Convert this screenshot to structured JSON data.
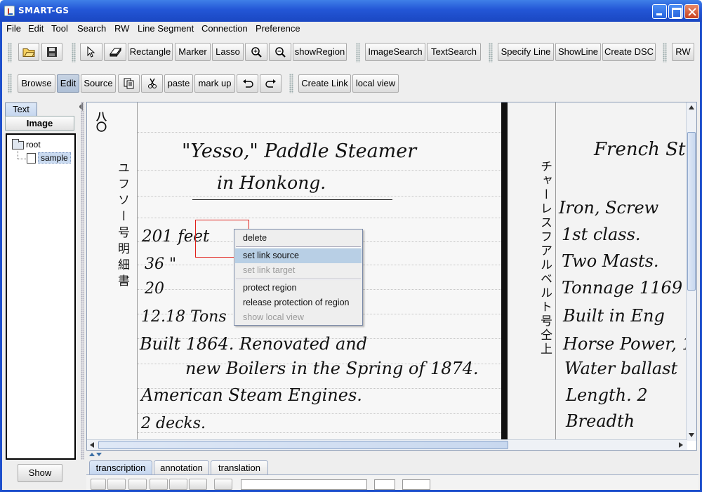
{
  "window": {
    "title": "SMART-GS"
  },
  "menu": [
    "File",
    "Edit",
    "Tool",
    "Search",
    "RW",
    "Line Segment",
    "Connection",
    "Preference"
  ],
  "toolbar1": {
    "open_icon": "open-folder-icon",
    "save_icon": "save-disk-icon",
    "pointer_icon": "pointer-arrow-icon",
    "eraser_icon": "eraser-icon",
    "rectangle": "Rectangle",
    "marker": "Marker",
    "lasso": "Lasso",
    "zoom_in_icon": "zoom-in-icon",
    "zoom_out_icon": "zoom-out-icon",
    "show_region": "showRegion",
    "image_search": "ImageSearch",
    "text_search": "TextSearch",
    "specify_line": "Specify Line",
    "show_line": "ShowLine",
    "create_dsc": "Create DSC",
    "rw": "RW"
  },
  "toolbar2": {
    "browse": "Browse",
    "edit": "Edit",
    "source": "Source",
    "copy_icon": "copy-icon",
    "cut_icon": "scissors-icon",
    "paste": "paste",
    "mark_up": "mark up",
    "undo_icon": "undo-icon",
    "redo_icon": "redo-icon",
    "create_link": "Create Link",
    "local_view": "local view"
  },
  "left_panel": {
    "tab_text": "Text",
    "tab_image": "Image",
    "tree": {
      "root": "root",
      "child": "sample"
    },
    "show_button": "Show"
  },
  "document": {
    "page_number": "八〇",
    "vertical_jp_left": "ユフソー号明細書",
    "vertical_jp_right": "チャーレスフアルベルト号仝上",
    "left_lines": [
      "\"Yesso,\" Paddle Steamer",
      "in Honkong.",
      "201   feet",
      "36   \"",
      "20",
      "12.18   Tons",
      "Built 1864.      Renovated and",
      "new Boilers in the Spring of 1874.",
      "American Steam Engines.",
      "2 decks."
    ],
    "right_lines": [
      "French Ste",
      "Iron, Screw",
      "1st class.",
      "Two Masts.",
      "Tonnage 1169",
      "Built in Eng",
      "Horse Power, 1",
      "Water ballast",
      "Length.  2",
      "Breadth"
    ]
  },
  "context_menu": {
    "items": [
      {
        "label": "delete",
        "state": "normal"
      },
      {
        "label": "set link source",
        "state": "highlighted"
      },
      {
        "label": "set link target",
        "state": "disabled"
      },
      {
        "label": "protect region",
        "state": "normal"
      },
      {
        "label": "release protection of region",
        "state": "normal"
      },
      {
        "label": "show local view",
        "state": "disabled"
      }
    ]
  },
  "bottom_tabs": [
    "transcription",
    "annotation",
    "translation"
  ],
  "colors": {
    "titlebar": "#2356d6",
    "selection_rect": "#e0201a",
    "menu_highlight": "#b8cfe5",
    "pressed_button": "#aebfd6"
  }
}
